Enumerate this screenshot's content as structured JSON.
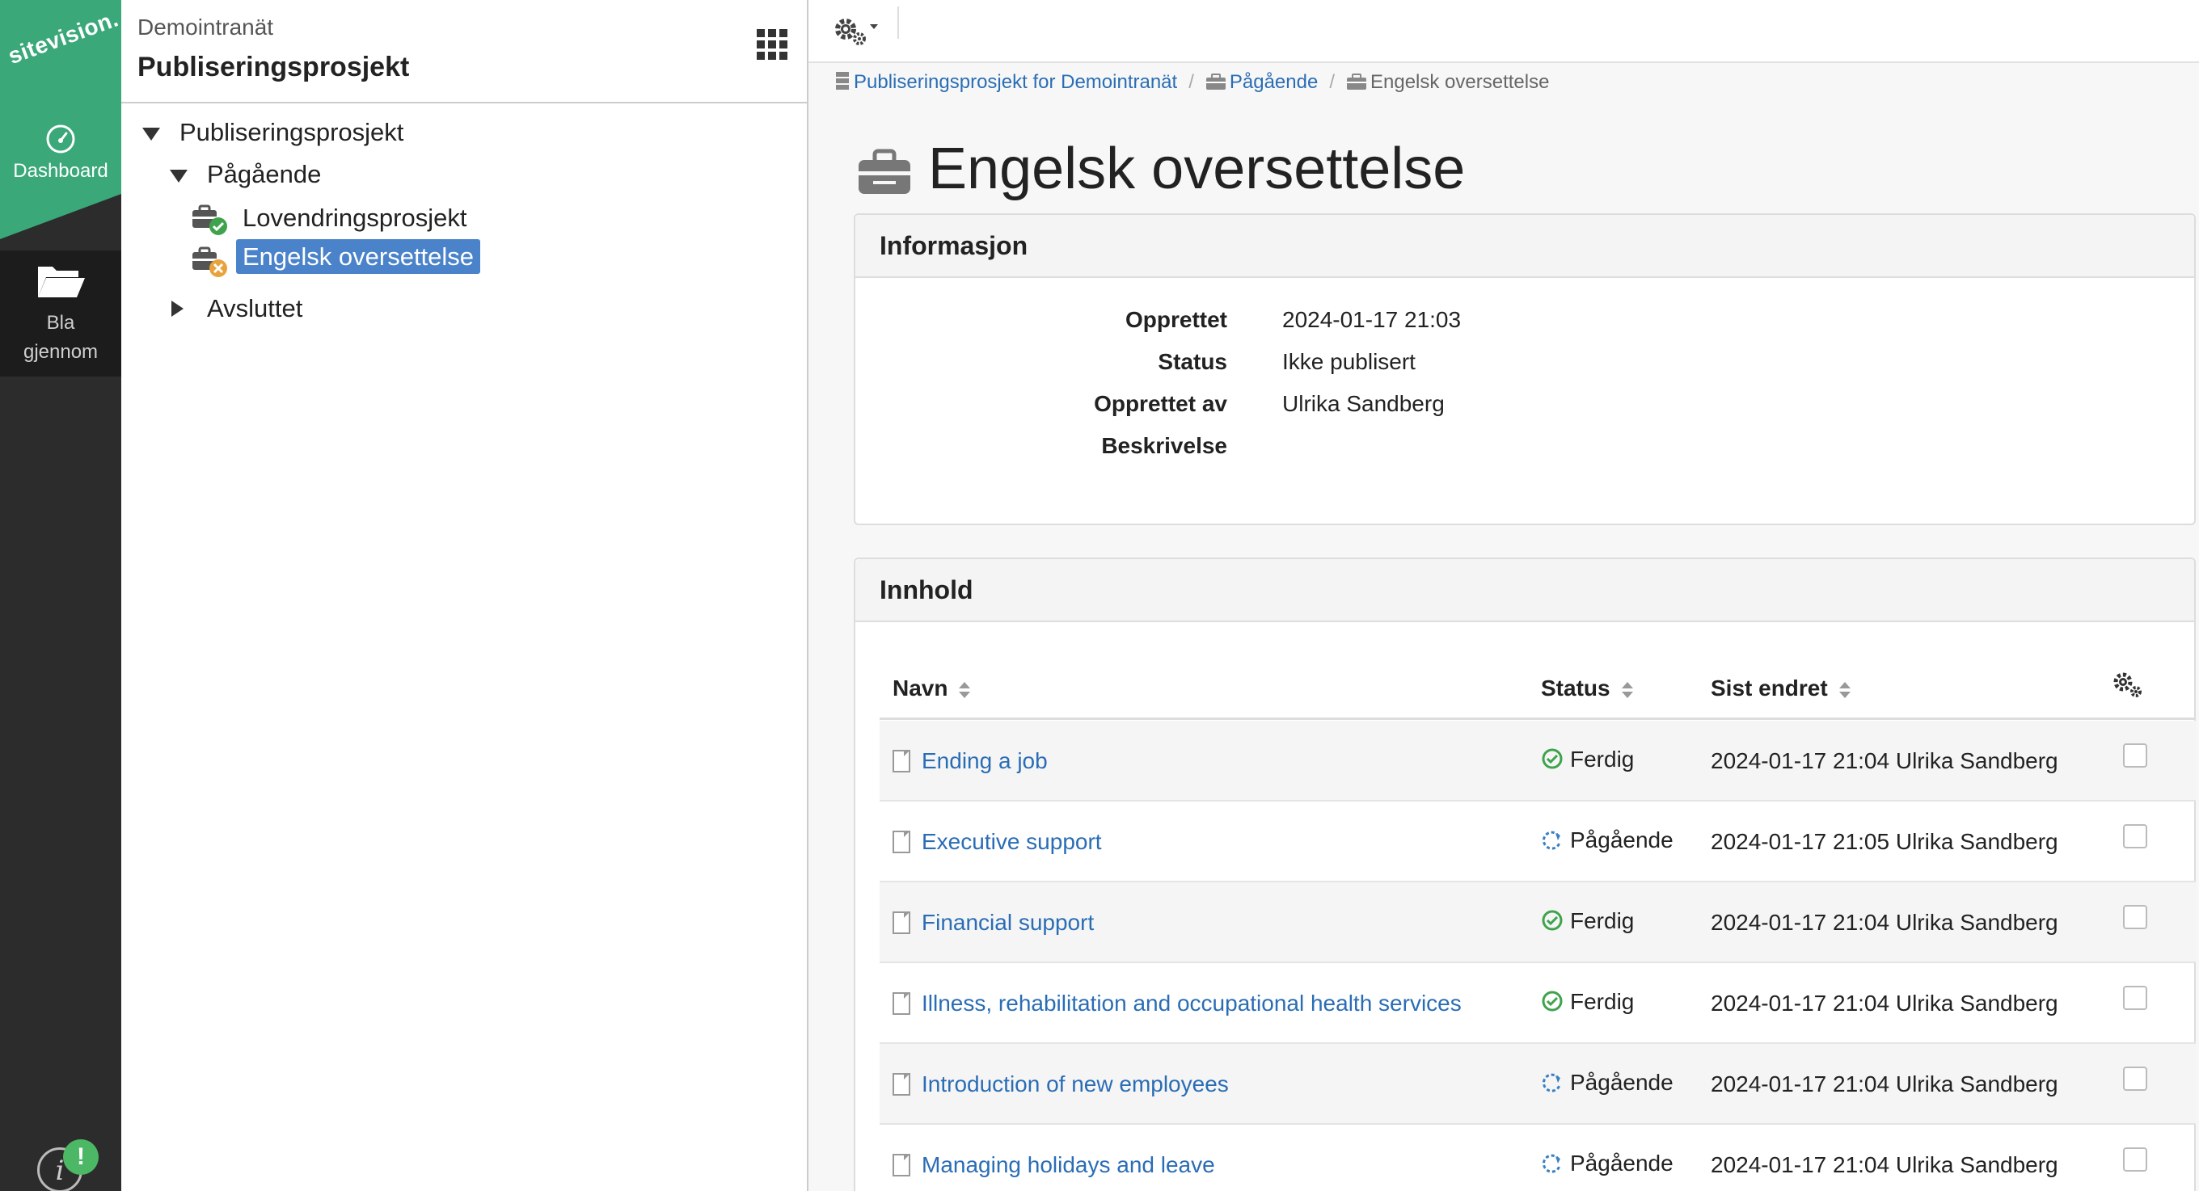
{
  "rail": {
    "logo_text": "sitevision.",
    "dashboard_label": "Dashboard",
    "browse_label_1": "Bla",
    "browse_label_2": "gjennom",
    "info_icon": "info-icon",
    "notification_badge": "!"
  },
  "tree_panel": {
    "site_name": "Demointranät",
    "project_name": "Publiseringsprosjekt",
    "nodes": {
      "root": "Publiseringsprosjekt",
      "ongoing": "Pågående",
      "child1": "Lovendringsprosjekt",
      "child2": "Engelsk oversettelse",
      "finished": "Avsluttet"
    }
  },
  "breadcrumb": {
    "item1": "Publiseringsprosjekt for Demointranät",
    "item2": "Pågående",
    "item3": "Engelsk oversettelse",
    "separator": "/"
  },
  "page": {
    "title": "Engelsk oversettelse"
  },
  "info": {
    "heading": "Informasjon",
    "created_label": "Opprettet",
    "created_value": "2024-01-17 21:03",
    "status_label": "Status",
    "status_value": "Ikke publisert",
    "created_by_label": "Opprettet av",
    "created_by_value": "Ulrika Sandberg",
    "description_label": "Beskrivelse",
    "description_value": ""
  },
  "content": {
    "heading": "Innhold",
    "columns": {
      "name": "Navn",
      "status": "Status",
      "modified": "Sist endret"
    },
    "rows": [
      {
        "name": "Ending a job",
        "status": "Ferdig",
        "modified": "2024-01-17 21:04 Ulrika Sandberg"
      },
      {
        "name": "Executive support",
        "status": "Pågående",
        "modified": "2024-01-17 21:05 Ulrika Sandberg"
      },
      {
        "name": "Financial support",
        "status": "Ferdig",
        "modified": "2024-01-17 21:04 Ulrika Sandberg"
      },
      {
        "name": "Illness, rehabilitation and occupational health services",
        "status": "Ferdig",
        "modified": "2024-01-17 21:04 Ulrika Sandberg"
      },
      {
        "name": "Introduction of new employees",
        "status": "Pågående",
        "modified": "2024-01-17 21:04 Ulrika Sandberg"
      },
      {
        "name": "Managing holidays and leave",
        "status": "Pågående",
        "modified": "2024-01-17 21:04 Ulrika Sandberg"
      }
    ]
  },
  "colors": {
    "brand_green": "#3aa879",
    "link_blue": "#2a6db5",
    "selection_blue": "#4a83c9",
    "done_green": "#3fa34d",
    "progress_blue": "#3a7fc4",
    "rail_dark": "#2c2c2c"
  }
}
